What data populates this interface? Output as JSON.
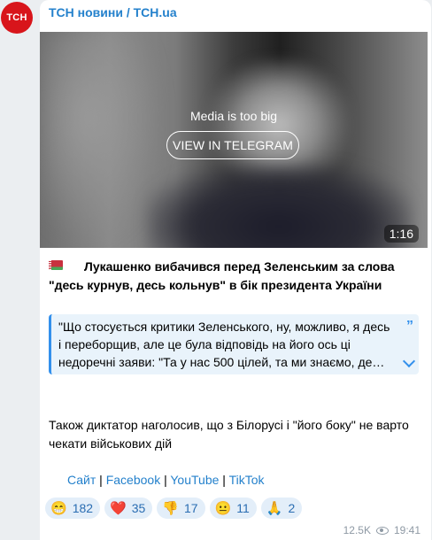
{
  "channel": {
    "avatar_text": "TCH",
    "name": "ТСН новини / TCH.ua"
  },
  "media": {
    "message": "Media is too big",
    "button_label": "VIEW IN TELEGRAM",
    "duration": "1:16"
  },
  "post": {
    "headline": "Лукашенко вибачився перед Зеленським за слова \"десь курнув, десь кольнув\" в бік президента України",
    "quote": "\"Що стосується критики Зеленського, ну, можливо, я десь і переборщив, але це була відповідь на його ось ці недоречні заяви: \"Та у нас 500 цілей, та ми знаємо, де…",
    "quote_mark": "”",
    "body": "Також диктатор наголосив, що з Білорусі і \"його боку\" не варто чекати військових дій"
  },
  "links": [
    {
      "label": "Сайт"
    },
    {
      "label": "Facebook"
    },
    {
      "label": "YouTube"
    },
    {
      "label": "TikTok"
    }
  ],
  "link_separator": " | ",
  "reactions": [
    {
      "emoji": "😁",
      "count": "182"
    },
    {
      "emoji": "❤️",
      "count": "35"
    },
    {
      "emoji": "👎",
      "count": "17"
    },
    {
      "emoji": "😐",
      "count": "11"
    },
    {
      "emoji": "🙏",
      "count": "2"
    }
  ],
  "meta": {
    "views": "12.5K",
    "time": "19:41"
  },
  "colors": {
    "accent": "#2481cc",
    "avatar_bg": "#d8151b",
    "quote_bg": "#e9f3fb"
  }
}
